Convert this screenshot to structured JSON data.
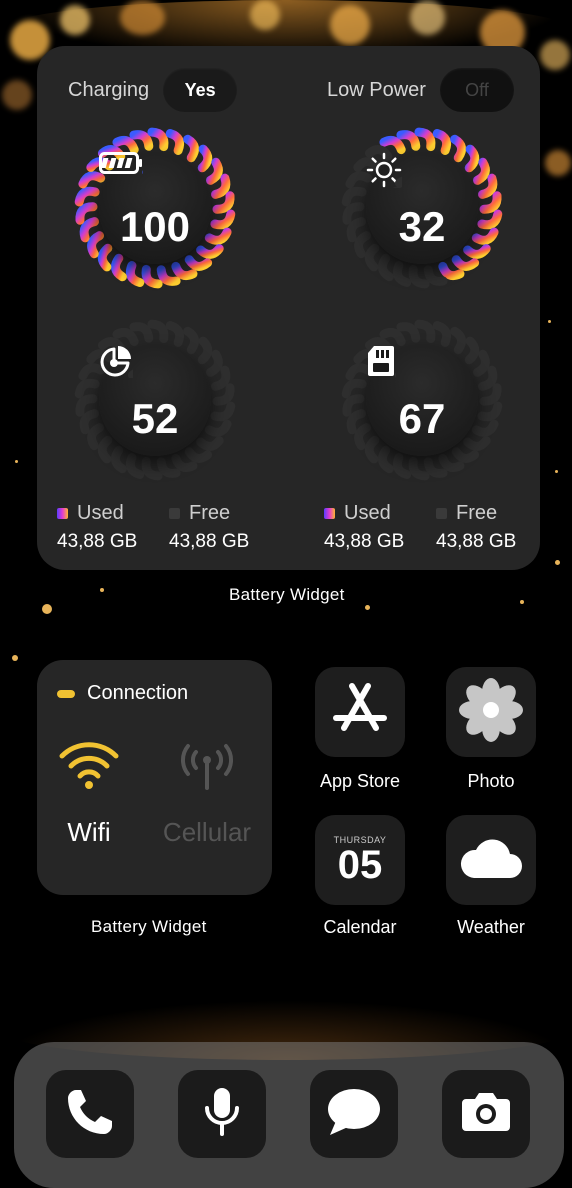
{
  "battery_widget": {
    "charging": {
      "label": "Charging",
      "state": "Yes"
    },
    "low_power": {
      "label": "Low Power",
      "state": "Off"
    },
    "gauges": [
      {
        "name": "battery",
        "icon": "battery-icon",
        "value": "100",
        "level": 1.0
      },
      {
        "name": "brightness",
        "icon": "sun-icon",
        "value": "32",
        "level": 0.32
      },
      {
        "name": "ram",
        "icon": "pie-chart-icon",
        "value": "52",
        "level": 0.52
      },
      {
        "name": "storage",
        "icon": "sd-card-icon",
        "value": "67",
        "level": 0.67
      }
    ],
    "storage_left": {
      "used_label": "Used",
      "used_value": "43,88 GB",
      "free_label": "Free",
      "free_value": "43,88 GB"
    },
    "storage_right": {
      "used_label": "Used",
      "used_value": "43,88 GB",
      "free_label": "Free",
      "free_value": "43,88 GB"
    },
    "caption": "Battery Widget"
  },
  "connection_widget": {
    "title": "Connection",
    "wifi_label": "Wifi",
    "cellular_label": "Cellular",
    "caption": "Battery Widget",
    "colors": {
      "active": "#f1c232",
      "inactive": "#555555"
    }
  },
  "apps": [
    {
      "label": "App Store",
      "icon": "app-store-icon"
    },
    {
      "label": "Photo",
      "icon": "photos-flower-icon"
    },
    {
      "label": "Calendar",
      "icon": "calendar-icon",
      "day": "THURSDAY",
      "date": "05"
    },
    {
      "label": "Weather",
      "icon": "cloud-icon"
    }
  ],
  "dock": [
    {
      "icon": "phone-icon"
    },
    {
      "icon": "microphone-icon"
    },
    {
      "icon": "message-bubble-icon"
    },
    {
      "icon": "camera-icon"
    }
  ]
}
